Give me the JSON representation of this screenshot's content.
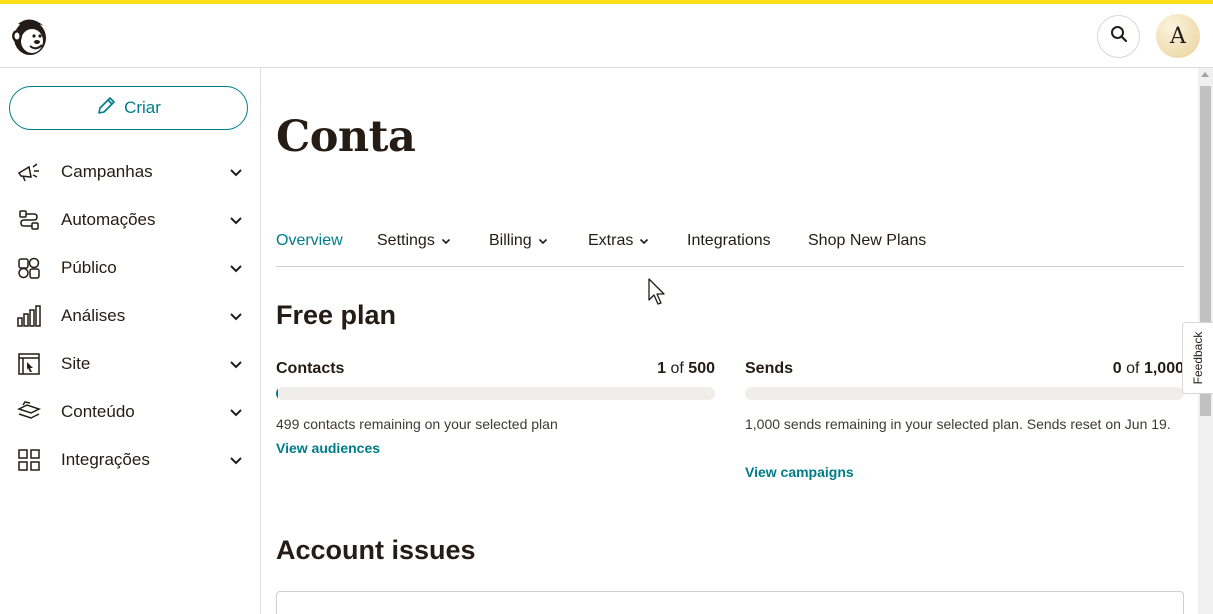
{
  "header": {
    "logo_icon": "mailchimp-freddie-logo",
    "search_icon": "search-icon",
    "avatar_initial": "A",
    "accent_color": "#ffe01b"
  },
  "sidebar": {
    "create_label": "Criar",
    "create_icon": "pencil-icon",
    "items": [
      {
        "label": "Campanhas",
        "icon": "megaphone-icon"
      },
      {
        "label": "Automações",
        "icon": "automation-icon"
      },
      {
        "label": "Público",
        "icon": "audience-icon"
      },
      {
        "label": "Análises",
        "icon": "bar-chart-icon"
      },
      {
        "label": "Site",
        "icon": "website-icon"
      },
      {
        "label": "Conteúdo",
        "icon": "content-icon"
      },
      {
        "label": "Integrações",
        "icon": "grid-icon"
      }
    ]
  },
  "main": {
    "title": "Conta",
    "tabs": [
      {
        "label": "Overview",
        "active": true,
        "has_dropdown": false
      },
      {
        "label": "Settings",
        "active": false,
        "has_dropdown": true
      },
      {
        "label": "Billing",
        "active": false,
        "has_dropdown": true
      },
      {
        "label": "Extras",
        "active": false,
        "has_dropdown": true
      },
      {
        "label": "Integrations",
        "active": false,
        "has_dropdown": false
      },
      {
        "label": "Shop New Plans",
        "active": false,
        "has_dropdown": false
      }
    ],
    "plan_title": "Free plan",
    "contacts": {
      "label": "Contacts",
      "used": "1",
      "of_text": "of",
      "limit": "500",
      "progress": 0.002,
      "note": "499 contacts remaining on your selected plan",
      "link": "View audiences"
    },
    "sends": {
      "label": "Sends",
      "used": "0",
      "of_text": "of",
      "limit": "1,000",
      "progress": 0.0,
      "note": "1,000 sends remaining in your selected plan. Sends reset on Jun 19.",
      "link": "View campaigns"
    },
    "issues_title": "Account issues"
  },
  "feedback_label": "Feedback",
  "colors": {
    "brand_teal": "#007c89",
    "text": "#241c15",
    "bar_track": "#efeeea"
  }
}
